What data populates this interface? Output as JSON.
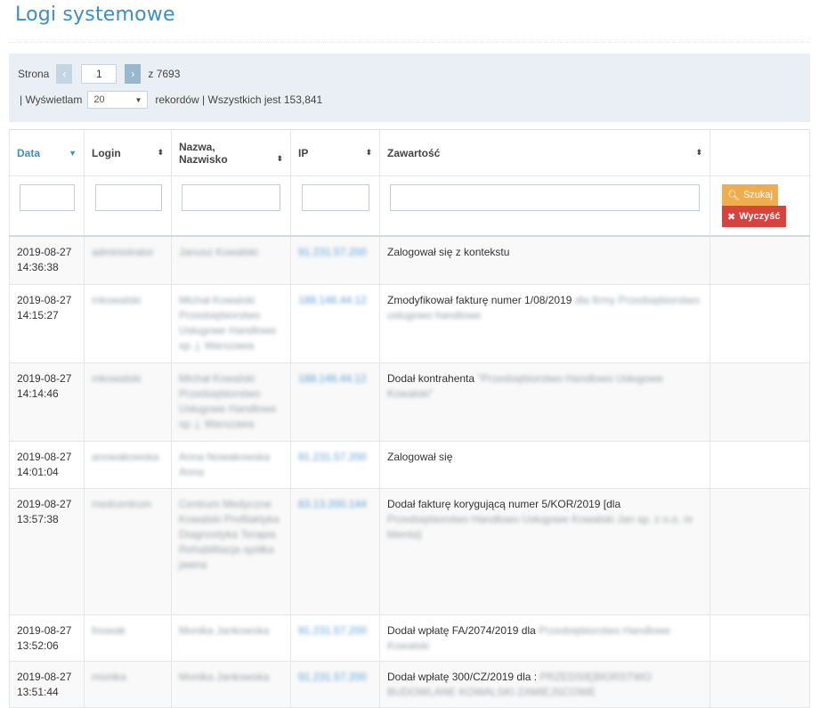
{
  "page": {
    "title": "Logi systemowe"
  },
  "pager": {
    "page_label": "Strona",
    "prev_icon": "‹",
    "next_icon": "›",
    "current_page": "1",
    "of_label": "z 7693",
    "showing_label": "| Wyświetlam",
    "per_page": "20",
    "records_label": "rekordów | Wszystkich jest 153,841"
  },
  "table": {
    "columns": {
      "date": "Data",
      "login": "Login",
      "name_line1": "Nazwa,",
      "name_line2": "Nazwisko",
      "ip": "IP",
      "content": "Zawartość"
    },
    "search_label": "Szukaj",
    "clear_label": "Wyczyść",
    "rows": [
      {
        "date": "2019-08-27",
        "time": "14:36:38",
        "login": "administrator",
        "name": "Janusz Kowalski",
        "ip": "91.231.57.200",
        "content": "Zalogował się z kontekstu",
        "content_extra": ""
      },
      {
        "date": "2019-08-27",
        "time": "14:15:27",
        "login": "mkowalski",
        "name": "Michał Kowalski Przedsiębiorstwo Usługowe Handlowe sp. j. Warszawa",
        "ip": "188.146.44.12",
        "content": "Zmodyfikował fakturę numer 1/08/2019",
        "content_extra": "dla firmy Przedsiębiorstwo usługowo handlowe"
      },
      {
        "date": "2019-08-27",
        "time": "14:14:46",
        "login": "mkowalski",
        "name": "Michał Kowalski Przedsiębiorstwo Usługowe Handlowe sp. j. Warszawa",
        "ip": "188.146.44.12",
        "content": "Dodał kontrahenta",
        "content_extra": "\"Przedsiębiorstwo Handlowo Usługowe Kowalski\""
      },
      {
        "date": "2019-08-27",
        "time": "14:01:04",
        "login": "anowakowska",
        "name": "Anna Nowakowska Anna",
        "ip": "91.231.57.200",
        "content": "Zalogował się",
        "content_extra": ""
      },
      {
        "date": "2019-08-27",
        "time": "13:57:38",
        "login": "medcentrum",
        "name": "Centrum Medyczne Kowalski Profilaktyka Diagnostyka Terapia Rehabilitacja spółka jawna",
        "ip": "83.13.200.144",
        "content": "Dodał fakturę korygującą numer 5/KOR/2019 [dla",
        "content_extra": "Przedsiębiorstwo Handlowo Usługowe Kowalski Jan sp. z o.o. nr klienta]"
      },
      {
        "date": "2019-08-27",
        "time": "13:52:06",
        "login": "fnowak",
        "name": "Monika Jankowska",
        "ip": "91.231.57.200",
        "content": "Dodał wpłatę FA/2074/2019 dla",
        "content_extra": "Przedsiębiorstwo Handlowe Kowalski"
      },
      {
        "date": "2019-08-27",
        "time": "13:51:44",
        "login": "monika",
        "name": "Monika Jankowska",
        "ip": "91.231.57.200",
        "content": "Dodał wpłatę 300/CZ/2019 dla :",
        "content_extra": "PRZEDSIĘBIORSTWO BUDOWLANE KOWALSKI ZAMIEJSCOWE"
      }
    ]
  },
  "colors": {
    "accent": "#3e8ec4",
    "search_button": "#f0ad4e",
    "clear_button": "#d9433d",
    "panel": "#e9eff4"
  },
  "icons": {
    "search": "search-icon",
    "clear": "close-icon",
    "sort": "sort-icon",
    "sort_desc": "sort-desc-icon"
  }
}
